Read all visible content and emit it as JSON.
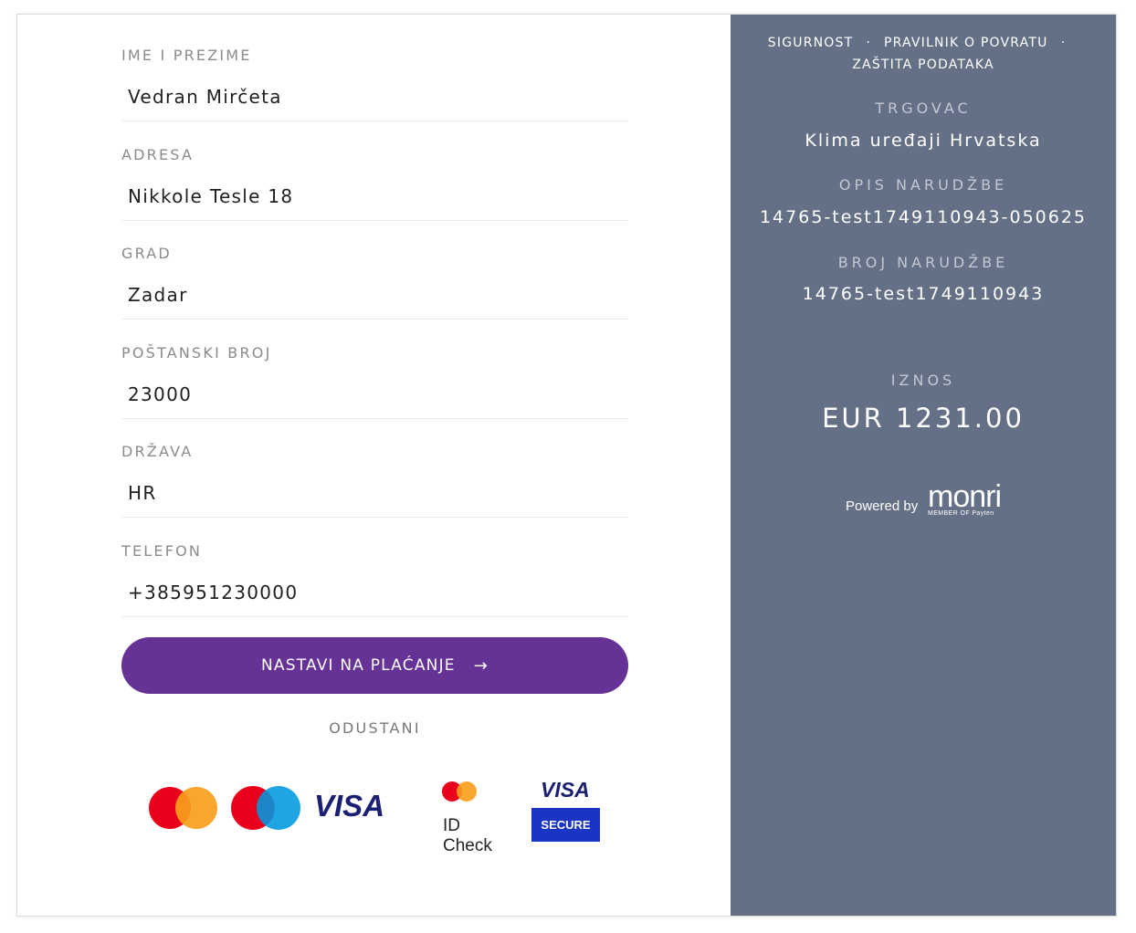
{
  "form": {
    "fields": [
      {
        "label": "IME I PREZIME",
        "value": "Vedran Mirčeta"
      },
      {
        "label": "ADRESA",
        "value": "Nikkole Tesle 18"
      },
      {
        "label": "GRAD",
        "value": "Zadar"
      },
      {
        "label": "POŠTANSKI BROJ",
        "value": "23000"
      },
      {
        "label": "DRŽAVA",
        "value": "HR"
      },
      {
        "label": "TELEFON",
        "value": "+385951230000"
      }
    ],
    "continue_label": "NASTAVI NA PLAĆANJE",
    "continue_arrow": "→",
    "cancel_label": "ODUSTANI"
  },
  "card_logos": {
    "visa": "VISA",
    "id_check": "ID Check",
    "visa_secure_top": "VISA",
    "visa_secure_bottom": "SECURE",
    "colors": {
      "mc_red": "#eb001b",
      "mc_orange": "#f79e1b",
      "maestro_blue": "#0099df",
      "visa_blue": "#1a1f71",
      "secure_blue": "#1a35c4"
    }
  },
  "sidebar": {
    "links": {
      "security": "SIGURNOST",
      "returns": "PRAVILNIK O POVRATU",
      "privacy": "ZAŠTITA PODATAKA",
      "separator": "·"
    },
    "merchant_label": "TRGOVAC",
    "merchant_value": "Klima uređaji Hrvatska",
    "order_desc_label": "OPIS NARUDŽBE",
    "order_desc_value": "14765-test1749110943-050625",
    "order_number_label": "BROJ NARUDŽBE",
    "order_number_value": "14765-test1749110943",
    "amount_label": "IZNOS",
    "amount_value": "EUR 1231.00",
    "powered_by": "Powered by",
    "brand": "monri",
    "brand_member": "MEMBER OF Payten"
  },
  "colors": {
    "sidebar_bg": "#647086",
    "button_bg": "#653296"
  }
}
